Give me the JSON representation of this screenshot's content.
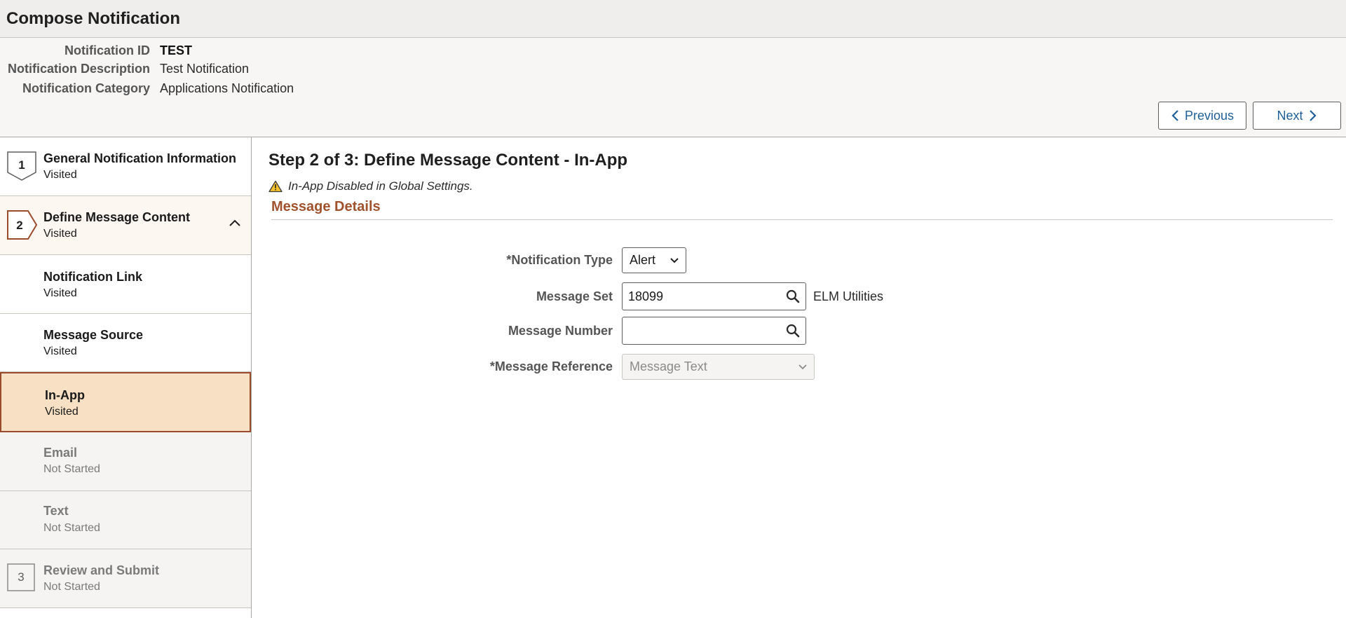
{
  "page": {
    "title": "Compose Notification"
  },
  "header": {
    "fields": [
      {
        "label": "Notification ID",
        "value": "TEST"
      },
      {
        "label": "Notification Description",
        "value": "Test Notification"
      },
      {
        "label": "Notification Category",
        "value": "Applications Notification"
      }
    ],
    "previous_label": "Previous",
    "next_label": "Next"
  },
  "steps": [
    {
      "number": "1",
      "title": "General Notification Information",
      "status": "Visited"
    },
    {
      "number": "2",
      "title": "Define Message Content",
      "status": "Visited",
      "expanded": true
    },
    {
      "title": "Notification Link",
      "status": "Visited"
    },
    {
      "title": "Message Source",
      "status": "Visited"
    },
    {
      "title": "In-App",
      "status": "Visited",
      "selected": true
    },
    {
      "title": "Email",
      "status": "Not Started"
    },
    {
      "title": "Text",
      "status": "Not Started"
    },
    {
      "number": "3",
      "title": "Review and Submit",
      "status": "Not Started"
    }
  ],
  "main": {
    "heading": "Step 2 of 3: Define Message Content - In-App",
    "warning": "In-App Disabled in Global Settings.",
    "section_title": "Message Details",
    "form": {
      "notification_type": {
        "label": "*Notification Type",
        "value": "Alert"
      },
      "message_set": {
        "label": "Message Set",
        "value": "18099",
        "description": "ELM Utilities"
      },
      "message_number": {
        "label": "Message Number",
        "value": ""
      },
      "message_reference": {
        "label": "*Message Reference",
        "placeholder": "Message Text"
      }
    }
  },
  "colors": {
    "accent": "#a0522d",
    "link": "#1f5f99",
    "active_step_bg": "#f7e0c3",
    "active_step_border": "#9b4a2c"
  },
  "icons": {
    "warning": "warning-triangle-icon",
    "search": "search-icon",
    "previous": "chevron-left-icon",
    "next": "chevron-right-icon",
    "collapse": "chevron-up-icon"
  }
}
